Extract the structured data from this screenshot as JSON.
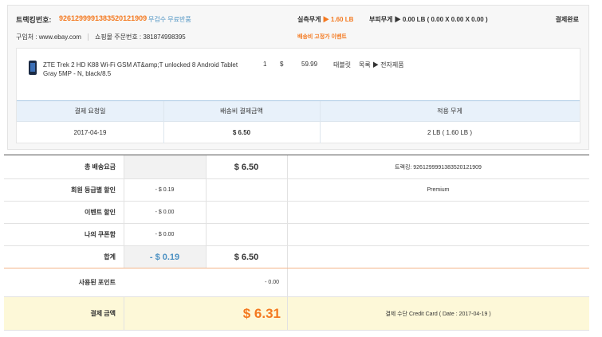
{
  "order": {
    "tracking_label": "트랙킹번호:",
    "tracking_number": "92612999913835201219​09",
    "free_return": "무검수 무료반품",
    "actual_weight_label": "실측무게",
    "actual_weight_value": "1.60 LB",
    "volume_weight": "부피무게 ▶ 0.00 LB ( 0.00 X 0.00 X 0.00 )",
    "status": "결제완료",
    "purchase_site": "구입처 : www.ebay.com",
    "mall_order_no": "쇼핑몰 주문번호 : 381874998395",
    "shipping_event": "배송비 고정가 이벤트"
  },
  "item": {
    "name": "ZTE Trek 2 HD K88 Wi-Fi GSM AT&amp;T unlocked 8 Android Tablet Gray 5MP - N, black/8.5",
    "qty": "1",
    "currency": "$",
    "price": "59.99",
    "category": "태블릿",
    "category_path": "목록 ▶ 전자제품"
  },
  "payment_table": {
    "headers": [
      "결제 요청일",
      "배송비 결제금액",
      "적용 무게"
    ],
    "row": [
      "2017-04-19",
      "$ 6.50",
      "2 LB ( 1.60 LB )"
    ]
  },
  "summary": {
    "total_shipping": {
      "label": "총 배송요금",
      "amount": "$ 6.50",
      "note": "트랙킹: 9261299991383520121909"
    },
    "member_discount": {
      "label": "회원 등급별 할인",
      "amount": "- $ 0.19",
      "note": "Premium"
    },
    "event_discount": {
      "label": "이벤트 할인",
      "amount": "- $ 0.00"
    },
    "coupon": {
      "label": "나의 쿠폰함",
      "amount": "- $ 0.00"
    },
    "subtotal": {
      "label": "합계",
      "discount": "- $ 0.19",
      "amount": "$ 6.50"
    },
    "points": {
      "label": "사용된 포인트",
      "amount": "- 0.00"
    },
    "payment": {
      "label": "결제 금액",
      "amount": "$ 6.31",
      "method": "결제 수단 Credit Card ( Date : 2017-04-19 )"
    }
  },
  "colors": {
    "accent_orange": "#f47920",
    "link_blue": "#4a90c2",
    "total_bg": "#fdf8d8"
  }
}
